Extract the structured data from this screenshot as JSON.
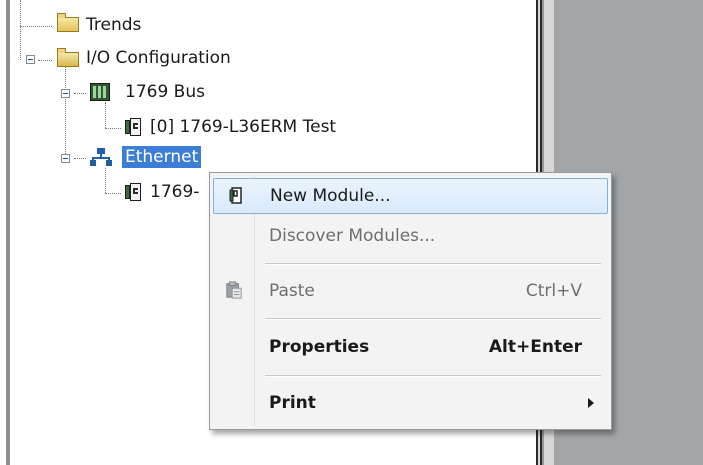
{
  "tree": {
    "nodes": [
      {
        "label": "Trends",
        "icon": "folder-icon"
      },
      {
        "label": "I/O Configuration",
        "icon": "folder-open-icon"
      },
      {
        "label": "1769 Bus",
        "icon": "rack-icon"
      },
      {
        "label": "[0] 1769-L36ERM Test",
        "icon": "module-icon"
      },
      {
        "label": "Ethernet",
        "icon": "network-icon",
        "selected": true
      },
      {
        "label": "1769-",
        "icon": "module-icon"
      }
    ]
  },
  "context_menu": {
    "items": [
      {
        "label": "New Module...",
        "shortcut": "",
        "state": "hover",
        "icon": "new-module-icon"
      },
      {
        "label": "Discover Modules...",
        "shortcut": "",
        "state": "disabled"
      },
      {
        "label": "Paste",
        "shortcut": "Ctrl+V",
        "state": "disabled",
        "icon": "clipboard-icon"
      },
      {
        "label": "Properties",
        "shortcut": "Alt+Enter",
        "state": "bold"
      },
      {
        "label": "Print",
        "shortcut": "",
        "state": "bold",
        "submenu": true
      }
    ]
  },
  "colors": {
    "selection": "#3c7ed6",
    "menu_hover": "#d9eafb",
    "right_pane": "#a3a6a9"
  }
}
